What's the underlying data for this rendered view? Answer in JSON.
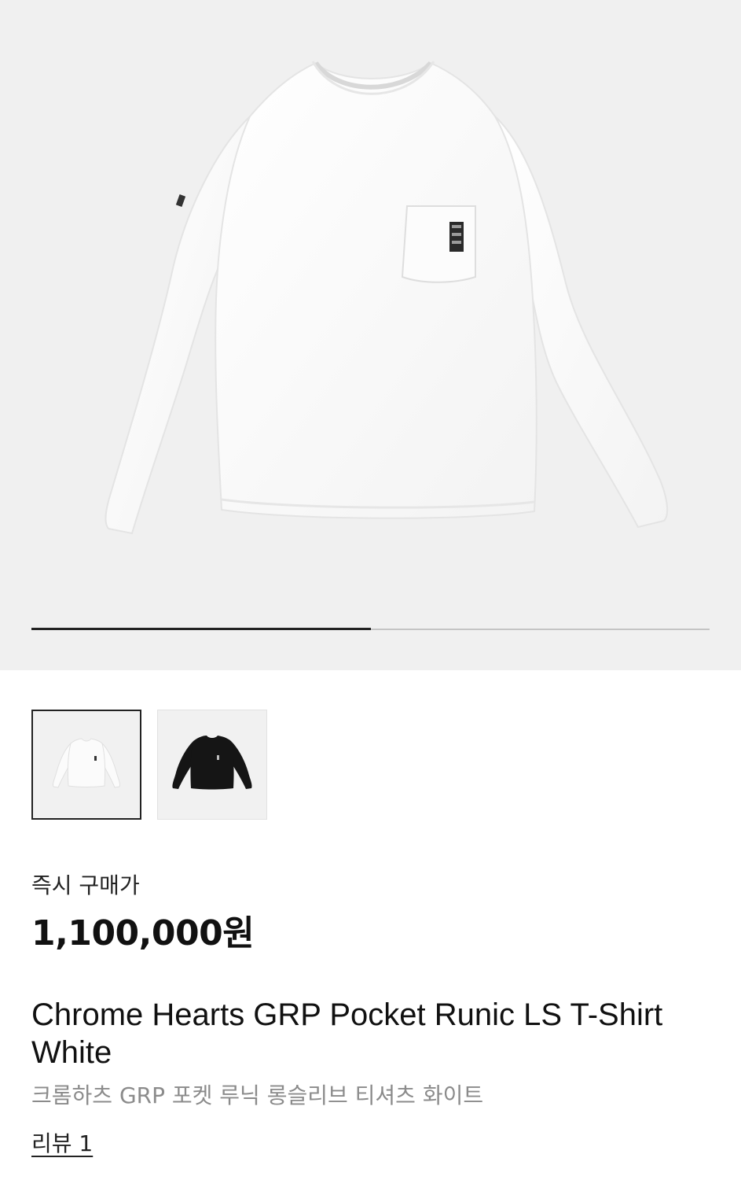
{
  "gallery": {
    "images": [
      {
        "icon": "white-longsleeve-tshirt-photo",
        "color": "#fbfbfb"
      },
      {
        "icon": "black-longsleeve-tshirt-photo",
        "color": "#111111"
      }
    ],
    "progress_fraction": 0.5,
    "selected_index": 0
  },
  "price": {
    "label": "즉시 구매가",
    "value": "1,100,000원"
  },
  "product": {
    "title": "Chrome Hearts GRP Pocket Runic LS T-Shirt White",
    "subtitle": "크롬하츠 GRP 포켓 루닉 롱슬리브 티셔츠 화이트",
    "reviews": "리뷰 1"
  }
}
